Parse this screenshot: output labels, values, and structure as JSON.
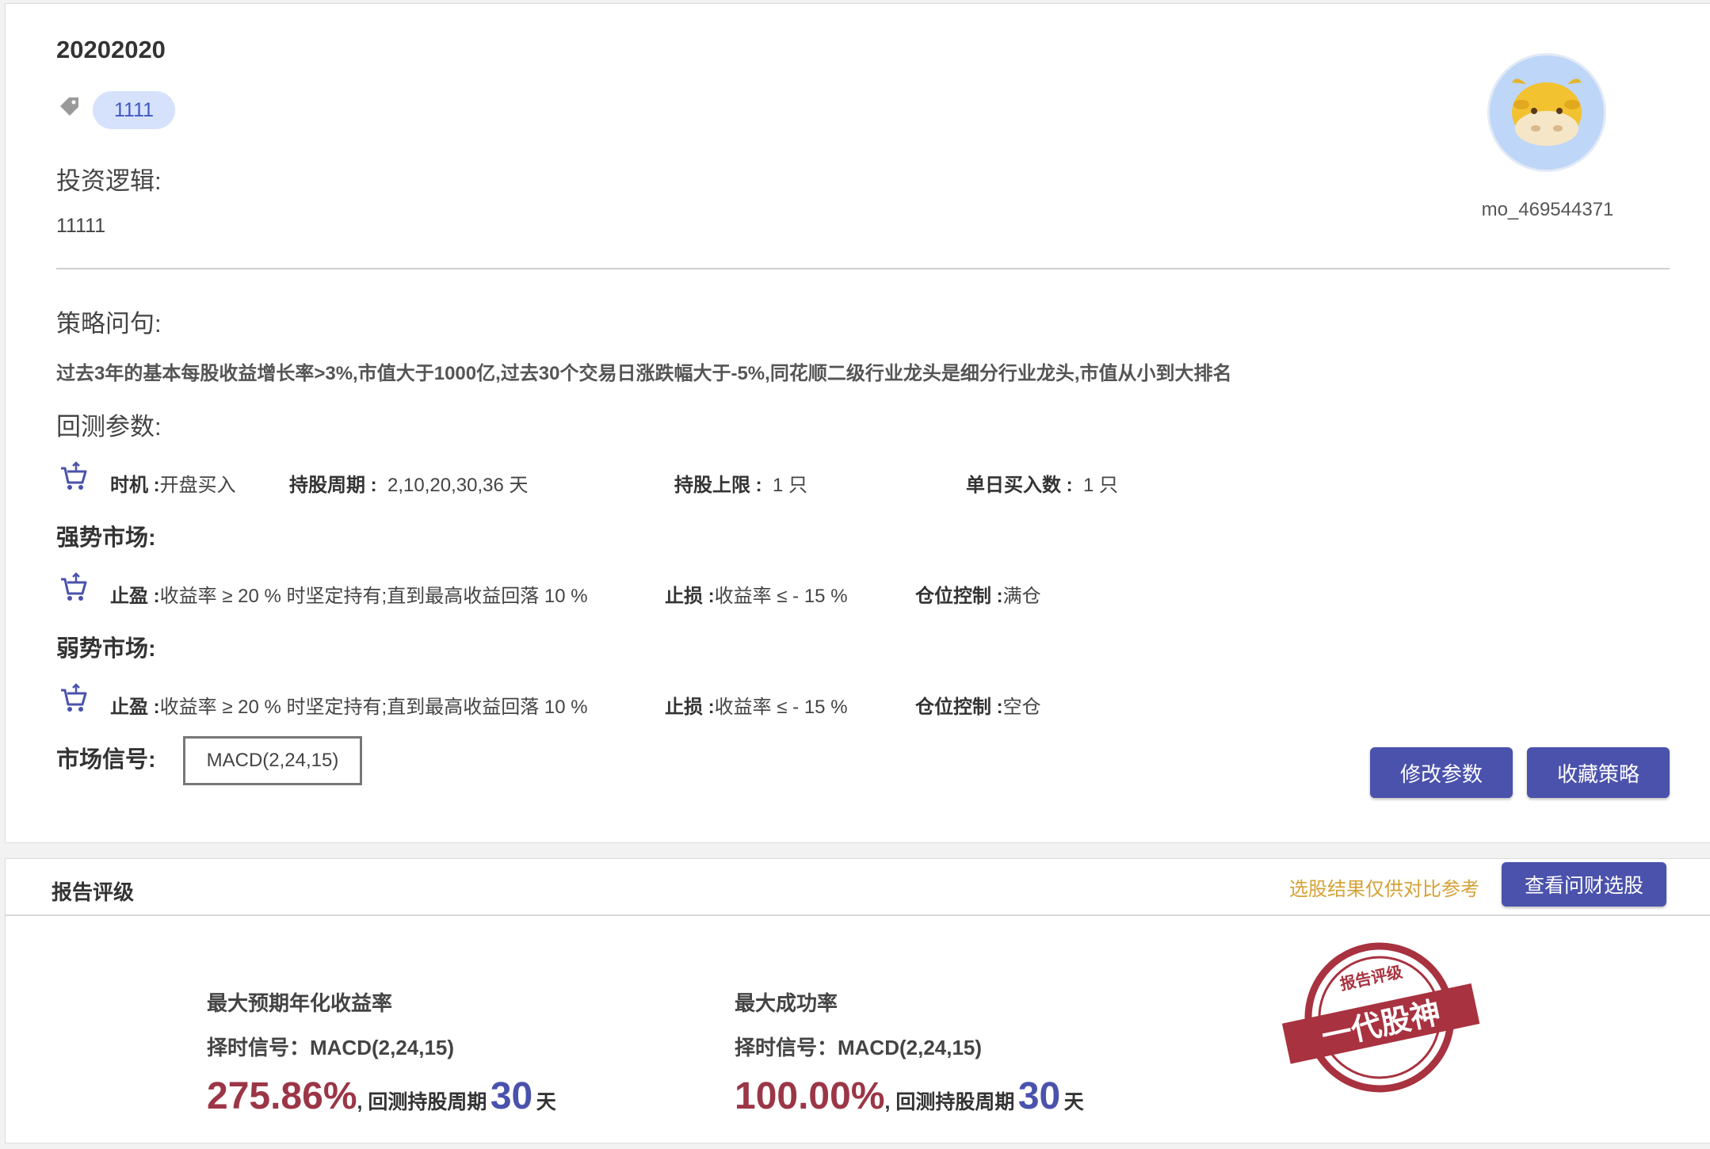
{
  "strategy": {
    "title": "20202020",
    "tag": "1111",
    "logic_label": "投资逻辑:",
    "logic_value": "11111",
    "query_label": "策略问句:",
    "query_text": "过去3年的基本每股收益增长率>3%,市值大于1000亿,过去30个交易日涨跌幅大于-5%,同花顺二级行业龙头是细分行业龙头,市值从小到大排名"
  },
  "user": {
    "name": "mo_469544371"
  },
  "backtest": {
    "label": "回测参数:",
    "timing_label": "时机 :",
    "timing_value": "开盘买入",
    "period_label": "持股周期 :",
    "period_value": "2,10,20,30,36  天",
    "limit_label": "持股上限 :",
    "limit_value": "1 只",
    "daily_label": "单日买入数 :",
    "daily_value": "1 只"
  },
  "strong_market": {
    "title": "强势市场:",
    "tp_label": "止盈 :",
    "tp_value": "收益率 ≥ 20 % 时坚定持有;直到最高收益回落 10 %",
    "sl_label": "止损 :",
    "sl_value": "收益率 ≤ - 15 %",
    "pos_label": "仓位控制 :",
    "pos_value": "满仓"
  },
  "weak_market": {
    "title": "弱势市场:",
    "tp_label": "止盈 :",
    "tp_value": "收益率 ≥ 20 % 时坚定持有;直到最高收益回落 10 %",
    "sl_label": "止损 :",
    "sl_value": "收益率 ≤ - 15 %",
    "pos_label": "仓位控制 :",
    "pos_value": "空仓"
  },
  "signal": {
    "label": "市场信号:",
    "value": "MACD(2,24,15)"
  },
  "buttons": {
    "modify": "修改参数",
    "favorite": "收藏策略",
    "view_stocks": "查看问财选股"
  },
  "report": {
    "title": "报告评级",
    "note": "选股结果仅供对比参考",
    "stamp_top": "报告评级",
    "stamp_main": "一代股神",
    "metrics": [
      {
        "label": "最大预期年化收益率",
        "signal": "择时信号：MACD(2,24,15)",
        "value": "275.86%",
        "sep": ", 回测持股周期",
        "days": "30",
        "unit": "天"
      },
      {
        "label": "最大成功率",
        "signal": "择时信号：MACD(2,24,15)",
        "value": "100.00%",
        "sep": ", 回测持股周期",
        "days": "30",
        "unit": "天"
      }
    ]
  },
  "colors": {
    "primary": "#4a52ac",
    "stamp": "#a8323f",
    "value_red": "#9b3647",
    "note_gold": "#d4a236",
    "tag_bg": "#d6e2fb"
  },
  "icons": [
    "tag-icon",
    "cart-icon",
    "avatar-cow-icon",
    "stamp-icon"
  ]
}
